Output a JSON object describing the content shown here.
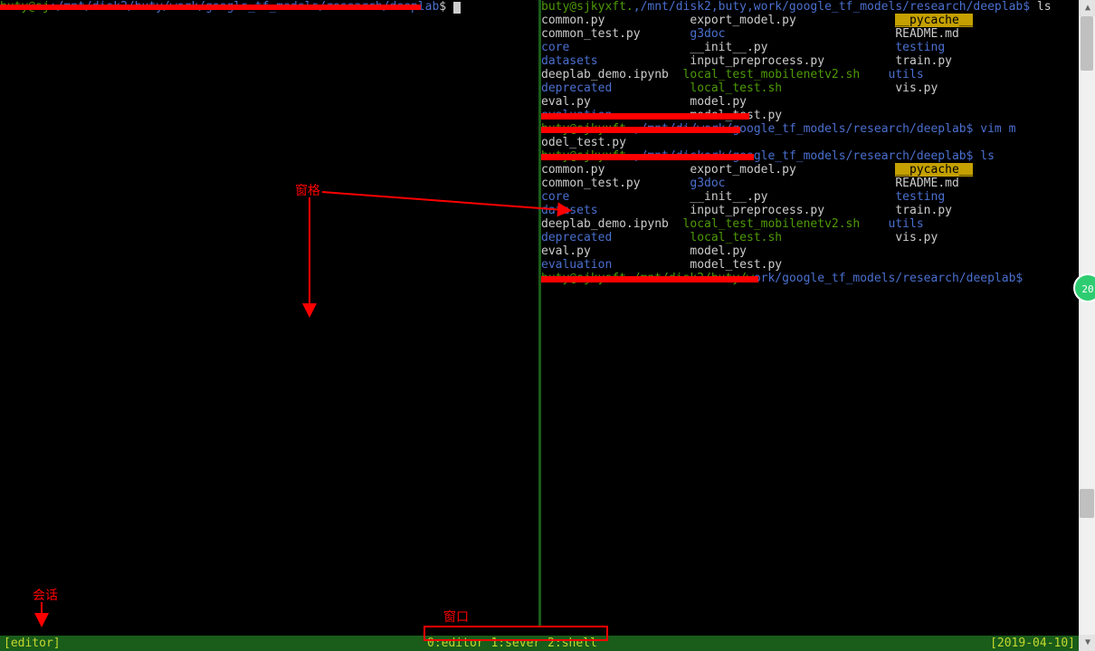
{
  "left_pane": {
    "prompt_visible": ":/mnt/disk2/buty/work/google_tf_models/research/",
    "cwd_tail": "deeplab",
    "prompt_suffix": "$ "
  },
  "right_pane": {
    "prompt_path": "/work/google_tf_models/research/deeplab",
    "ls1": {
      "col1": [
        "common.py",
        "common_test.py",
        "core",
        "datasets",
        "deeplab_demo.ipynb",
        "deprecated",
        "eval.py",
        "evaluation"
      ],
      "col2": [
        "export_model.py",
        "g3doc",
        "__init__.py",
        "input_preprocess.py",
        "local_test_mobilenetv2.sh",
        "local_test.sh",
        "model.py",
        "model_test.py"
      ],
      "col3": [
        "__pycache__",
        "README.md",
        "testing",
        "train.py",
        "utils",
        "vis.py",
        "",
        ""
      ]
    },
    "cmd_vim": "vim model_test.py",
    "cmd_ls": "ls",
    "ls2": {
      "col1": [
        "common.py",
        "common_test.py",
        "core",
        "datasets",
        "deeplab_demo.ipynb",
        "deprecated",
        "eval.py",
        "evaluation"
      ],
      "col2": [
        "export_model.py",
        "g3doc",
        "__init__.py",
        "input_preprocess.py",
        "local_test_mobilenetv2.sh",
        "local_test.sh",
        "model.py",
        "model_test.py"
      ],
      "col3": [
        "__pycache__",
        "README.md",
        "testing",
        "train.py",
        "utils",
        "vis.py",
        "",
        ""
      ]
    },
    "dir_entries": [
      "core",
      "datasets",
      "deprecated",
      "evaluation",
      "g3doc",
      "__pycache__",
      "testing",
      "utils"
    ],
    "prompt_host_fragment": "buty@sjkyxft.",
    "partial_prompt_1": ",/mnt/disk2,buty,work/google_tf_models/research/deeplab$ ",
    "partial_prompt_2": "/work/google_tf_models/research/deeplab$ vim m",
    "partial_prompt_3": "ork/google_tf_models/research/deeplab$ ls",
    "partial_prompt_4": "ork/google_tf_models/research/deeplab$"
  },
  "statusbar": {
    "session": "[editor]",
    "windows": "0:editor 1:sever 2:shell",
    "date": "[2019-04-10]"
  },
  "annotations": {
    "pane_label": "窗格",
    "window_label": "窗口",
    "session_label": "会话"
  },
  "badge": {
    "text": "20"
  }
}
